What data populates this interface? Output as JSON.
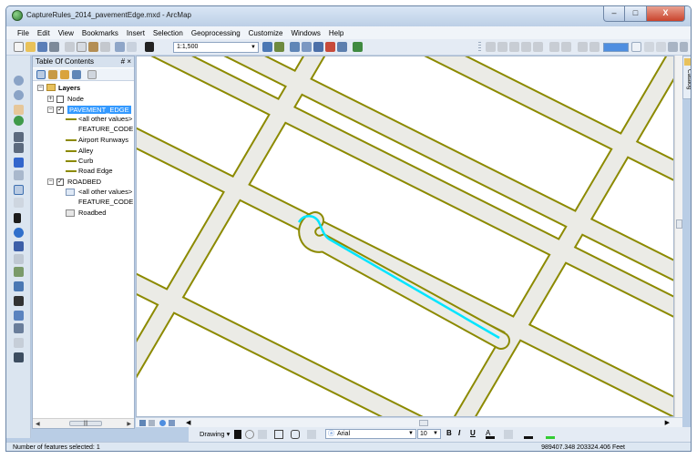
{
  "window": {
    "title": "CaptureRules_2014_pavementEdge.mxd - ArcMap",
    "buttons": {
      "minimize": "–",
      "maximize": "□",
      "close": "X"
    }
  },
  "menu": [
    "File",
    "Edit",
    "View",
    "Bookmarks",
    "Insert",
    "Selection",
    "Geoprocessing",
    "Customize",
    "Windows",
    "Help"
  ],
  "toolbar": {
    "scale": "1:1,500"
  },
  "toc": {
    "title": "Table Of Contents",
    "pin": "# ×",
    "root": "Layers",
    "layers": {
      "node": "Node",
      "pavement_edge": "PAVEMENT_EDGE",
      "all_other_values": "<all other values>",
      "feature_code": "FEATURE_CODE",
      "airport_runways": "Airport Runways",
      "alley": "Alley",
      "curb": "Curb",
      "road_edge": "Road Edge",
      "roadbed": "ROADBED",
      "rb_all_other_values": "<all other values>",
      "rb_feature_code": "FEATURE_CODE",
      "rb_roadbed": "Roadbed"
    }
  },
  "catalog": {
    "label": "Catalog"
  },
  "drawing": {
    "label": "Drawing ▾",
    "font": "Arial",
    "size": "10",
    "bold": "B",
    "italic": "I",
    "underline": "U"
  },
  "status": {
    "selected": "Number of features selected: 1",
    "coordinates": "989407.348  203324.406 Feet"
  },
  "colors": {
    "road_fill": "#ebebe6",
    "pavement_edge": "#8c8a00",
    "selection": "#00e5ff",
    "toc_selection": "#3399ff"
  }
}
